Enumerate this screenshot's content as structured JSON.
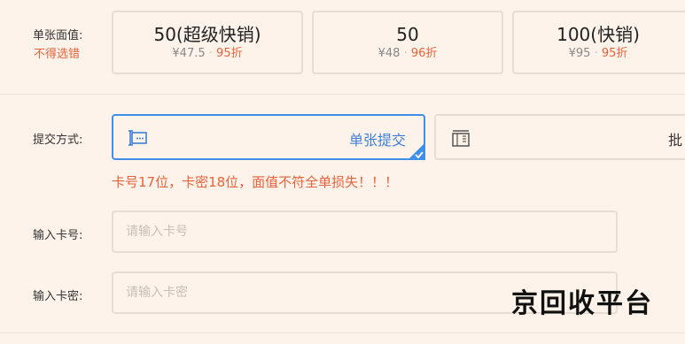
{
  "denomination": {
    "label": "单张面值:",
    "note": "不得选错",
    "cards": [
      {
        "name": "50(超级快销)",
        "price": "¥47.5",
        "discount": "95折"
      },
      {
        "name": "50",
        "price": "¥48",
        "discount": "96折"
      },
      {
        "name": "100(快销)",
        "price": "¥95",
        "discount": "95折"
      }
    ],
    "separator": "·"
  },
  "submit_method": {
    "label": "提交方式:",
    "options": [
      {
        "label": "单张提交",
        "icon": "single-card-icon",
        "selected": true
      },
      {
        "label": "批",
        "icon": "batch-cards-icon",
        "selected": false
      }
    ],
    "warning": "卡号17位，卡密18位，面值不符全单损失！！！"
  },
  "card_number": {
    "label": "输入卡号:",
    "placeholder": "请输入卡号",
    "value": ""
  },
  "card_password": {
    "label": "输入卡密:",
    "placeholder": "请输入卡密",
    "value": ""
  },
  "watermark": "京回收平台",
  "colors": {
    "accent_blue": "#3f8fe6",
    "warning": "#e8623a",
    "background": "#fdf3ea"
  }
}
